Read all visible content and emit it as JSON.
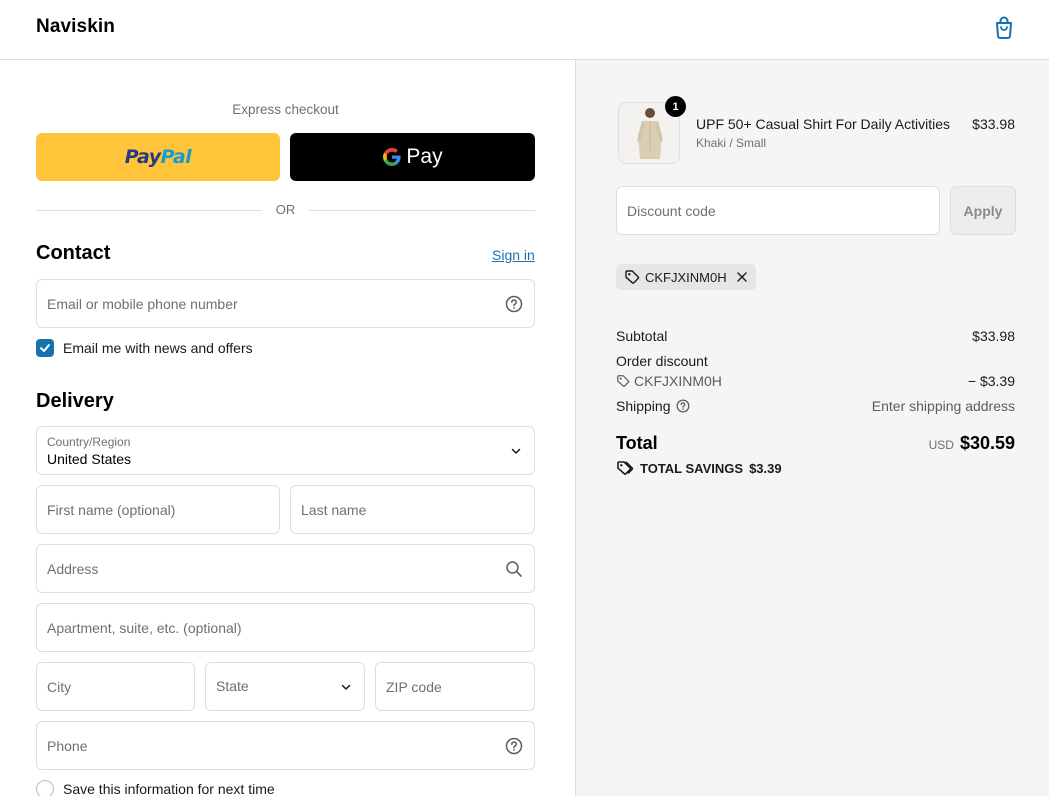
{
  "header": {
    "brand": "Naviskin",
    "cart_icon": "shopping-bag-icon"
  },
  "express": {
    "label": "Express checkout",
    "paypal_part1": "Pay",
    "paypal_part2": "Pal",
    "gpay_label": "Pay",
    "or": "OR"
  },
  "contact": {
    "title": "Contact",
    "sign_in": "Sign in",
    "email_placeholder": "Email or mobile phone number",
    "newsletter_label": "Email me with news and offers",
    "newsletter_checked": true
  },
  "delivery": {
    "title": "Delivery",
    "country_label": "Country/Region",
    "country_value": "United States",
    "first_name": "First name (optional)",
    "last_name": "Last name",
    "address": "Address",
    "apartment": "Apartment, suite, etc. (optional)",
    "city": "City",
    "state": "State",
    "zip": "ZIP code",
    "phone": "Phone",
    "save_info": "Save this information for next time"
  },
  "order": {
    "quantity": "1",
    "product_name": "UPF 50+ Casual Shirt For Daily Activities",
    "product_variant": "Khaki / Small",
    "product_price": "$33.98",
    "discount_placeholder": "Discount code",
    "apply": "Apply",
    "applied_code": "CKFJXINM0H",
    "subtotal_label": "Subtotal",
    "subtotal_value": "$33.98",
    "order_discount_label": "Order discount",
    "discount_code": "CKFJXINM0H",
    "discount_value": "− $3.39",
    "shipping_label": "Shipping",
    "shipping_value": "Enter shipping address",
    "total_label": "Total",
    "currency": "USD",
    "total_value": "$30.59",
    "savings_label": "TOTAL SAVINGS",
    "savings_value": "$3.39"
  },
  "colors": {
    "link": "#1773b0",
    "paypal_yellow": "#ffc439",
    "summary_bg": "#f5f5f5"
  }
}
